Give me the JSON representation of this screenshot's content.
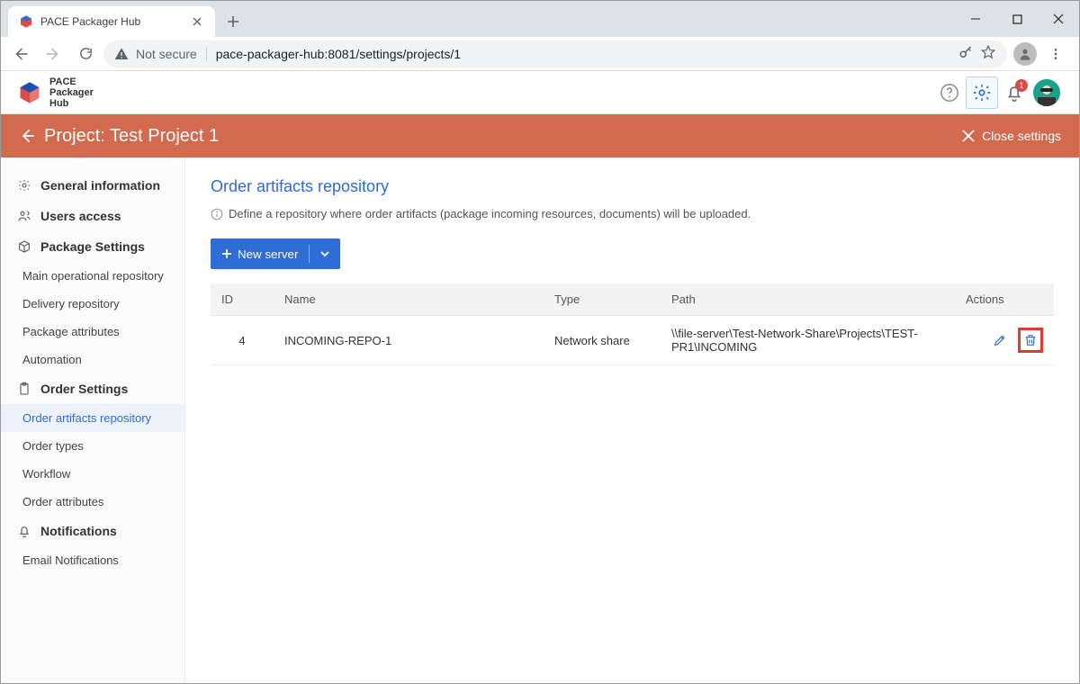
{
  "browser": {
    "tab_title": "PACE Packager Hub",
    "not_secure_label": "Not secure",
    "url": "pace-packager-hub:8081/settings/projects/1"
  },
  "brand": {
    "line1": "PACE",
    "line2": "Packager",
    "line3": "Hub"
  },
  "notifications_badge": "1",
  "page_bar": {
    "title": "Project: Test Project 1",
    "close_label": "Close settings"
  },
  "sidebar": {
    "sections": [
      {
        "label": "General information",
        "icon": "gear"
      },
      {
        "label": "Users access",
        "icon": "users"
      },
      {
        "label": "Package Settings",
        "icon": "cube",
        "items": [
          "Main operational repository",
          "Delivery repository",
          "Package attributes",
          "Automation"
        ]
      },
      {
        "label": "Order Settings",
        "icon": "clipboard",
        "items": [
          "Order artifacts repository",
          "Order types",
          "Workflow",
          "Order attributes"
        ],
        "active_index": 0
      },
      {
        "label": "Notifications",
        "icon": "bell",
        "items": [
          "Email Notifications"
        ]
      }
    ]
  },
  "content": {
    "heading": "Order artifacts repository",
    "info": "Define a repository where order artifacts (package incoming resources, documents) will be uploaded.",
    "new_server_label": "New server",
    "columns": {
      "id": "ID",
      "name": "Name",
      "type": "Type",
      "path": "Path",
      "actions": "Actions"
    },
    "rows": [
      {
        "id": "4",
        "name": "INCOMING-REPO-1",
        "type": "Network share",
        "path": "\\\\file-server\\Test-Network-Share\\Projects\\TEST-PR1\\INCOMING"
      }
    ]
  }
}
